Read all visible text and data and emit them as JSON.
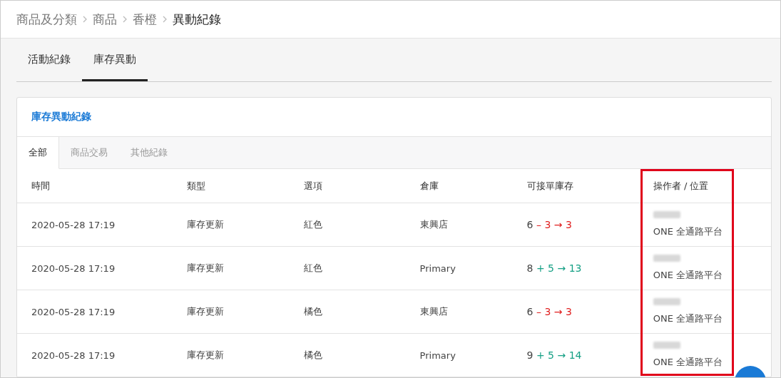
{
  "breadcrumb": [
    {
      "label": "商品及分類",
      "current": false
    },
    {
      "label": "商品",
      "current": false
    },
    {
      "label": "香橙",
      "current": false
    },
    {
      "label": "異動紀錄",
      "current": true
    }
  ],
  "tabs": [
    {
      "label": "活動紀錄",
      "selected": false
    },
    {
      "label": "庫存異動",
      "selected": true
    }
  ],
  "card": {
    "title": "庫存異動紀錄",
    "subtabs": [
      {
        "label": "全部",
        "selected": true
      },
      {
        "label": "商品交易",
        "selected": false
      },
      {
        "label": "其他紀錄",
        "selected": false
      }
    ],
    "table": {
      "columns": [
        {
          "label": "時間",
          "highlighted": false
        },
        {
          "label": "類型",
          "highlighted": false
        },
        {
          "label": "選項",
          "highlighted": false
        },
        {
          "label": "倉庫",
          "highlighted": false
        },
        {
          "label": "可接單庫存",
          "highlighted": false
        },
        {
          "label": "操作者 / 位置",
          "highlighted": true
        }
      ],
      "rows": [
        {
          "time": "2020-05-28 17:19",
          "type": "庫存更新",
          "option": "紅色",
          "warehouse": "東興店",
          "stock": {
            "kind": "decrease",
            "before": "6",
            "change": "– 3",
            "arrow": "→",
            "after": "3"
          },
          "operator_location": "ONE 全通路平台"
        },
        {
          "time": "2020-05-28 17:19",
          "type": "庫存更新",
          "option": "紅色",
          "warehouse": "Primary",
          "stock": {
            "kind": "increase",
            "before": "8",
            "change": "+ 5",
            "arrow": "→",
            "after": "13"
          },
          "operator_location": "ONE 全通路平台"
        },
        {
          "time": "2020-05-28 17:19",
          "type": "庫存更新",
          "option": "橘色",
          "warehouse": "東興店",
          "stock": {
            "kind": "decrease",
            "before": "6",
            "change": "– 3",
            "arrow": "→",
            "after": "3"
          },
          "operator_location": "ONE 全通路平台"
        },
        {
          "time": "2020-05-28 17:19",
          "type": "庫存更新",
          "option": "橘色",
          "warehouse": "Primary",
          "stock": {
            "kind": "increase",
            "before": "9",
            "change": "+ 5",
            "arrow": "→",
            "after": "14"
          },
          "operator_location": "ONE 全通路平台"
        }
      ]
    }
  }
}
